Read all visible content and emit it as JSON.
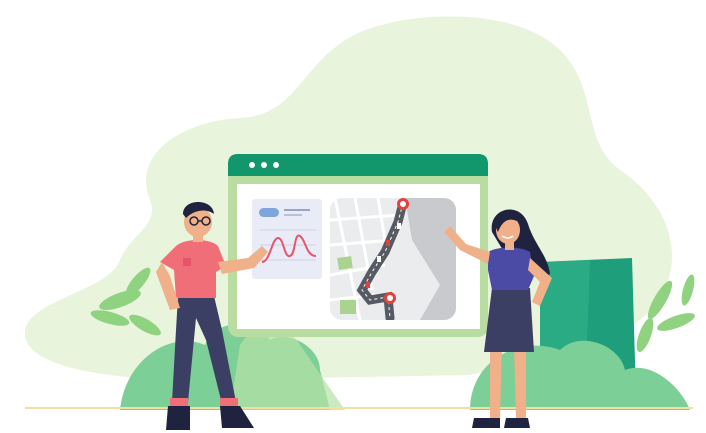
{
  "palette": {
    "backdrop_blob": "#e9f4dc",
    "window_frame": "#b9dca0",
    "window_titlebar": "#12966b",
    "ground_line": "#f3dfa0",
    "foliage_dark": "#1e9e7a",
    "foliage_light": "#7ccf97",
    "man_shirt": "#f06e77",
    "man_pants": "#3b3f63",
    "woman_top": "#4b4aa5",
    "woman_skirt": "#3b3f63",
    "skin": "#f0b08a",
    "hair": "#1f2340",
    "route_line": "#555a63",
    "map_base": "#d6d7d9",
    "map_park": "#a9d38e",
    "pin": "#e0433d",
    "chart_curve": "#e4576c",
    "chart_card": "#e9ebf6"
  },
  "icons": {
    "window_dots": "three-dot-window-controls-icon",
    "map_pin": "map-pin-icon",
    "car": "car-icon",
    "chart": "line-chart-icon"
  }
}
